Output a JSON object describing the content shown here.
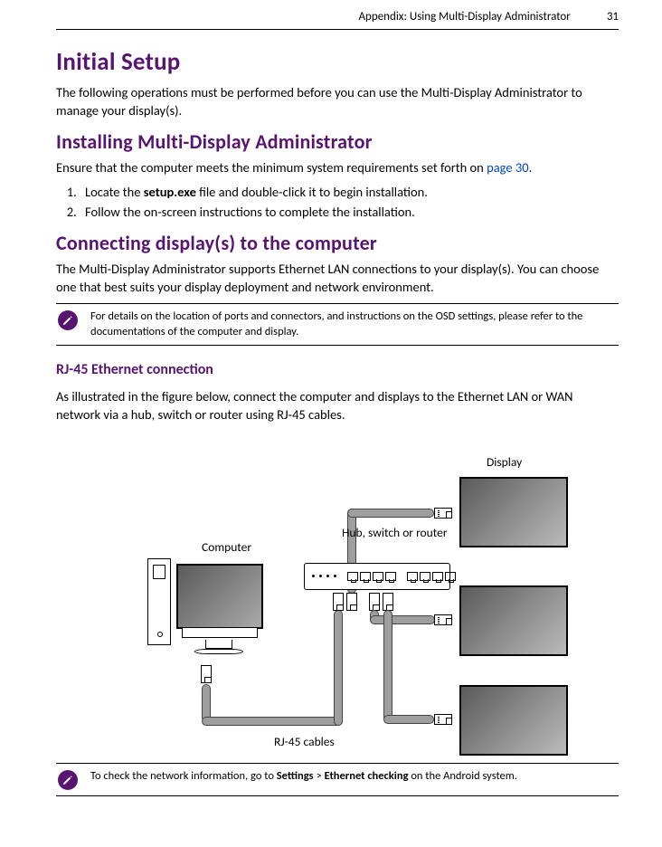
{
  "header": {
    "title": "Appendix: Using Multi-Display Administrator",
    "page_number": "31"
  },
  "h1": "Initial Setup",
  "intro": "The following operations must be performed before you can use the Multi-Display Administrator to manage your display(s).",
  "h2_install": "Installing Multi-Display Administrator",
  "install_lead_a": "Ensure that the computer meets the minimum system requirements set forth on ",
  "install_link": "page 30",
  "install_lead_b": ".",
  "steps": {
    "s1a": "Locate the ",
    "s1b": "setup.exe",
    "s1c": " file and double-click it to begin installation.",
    "s2": "Follow the on-screen instructions to complete the installation."
  },
  "h2_connect": "Connecting display(s) to the computer",
  "connect_body": "The Multi-Display Administrator supports Ethernet LAN connections to your display(s). You can choose one that best suits your display deployment and network environment.",
  "note1": "For details on the location of ports and connectors, and instructions on the OSD settings, please refer to the documentations of the computer and display.",
  "h3_rj45": "RJ-45 Ethernet connection",
  "rj45_body": "As illustrated in the figure below, connect the computer and displays to the Ethernet LAN or WAN network via a hub, switch or router using RJ-45 cables.",
  "diagram": {
    "label_display": "Display",
    "label_computer": "Computer",
    "label_switch": "Hub, switch or router",
    "label_cables": "RJ-45 cables"
  },
  "note2a": "To check the network information, go to ",
  "note2b": "Settings",
  "note2c": " > ",
  "note2d": "Ethernet checking",
  "note2e": " on the Android system."
}
